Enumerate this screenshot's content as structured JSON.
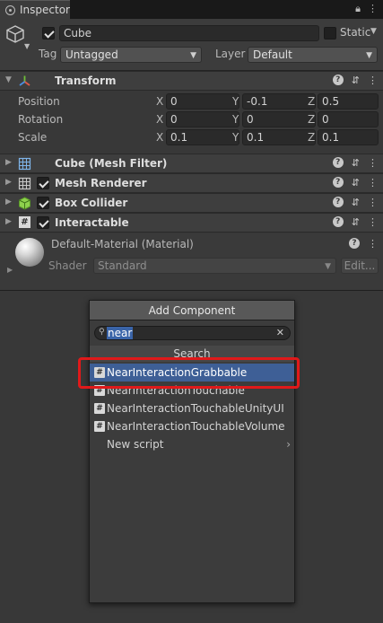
{
  "tab": {
    "title": "Inspector"
  },
  "object": {
    "name": "Cube",
    "static_label": "Static",
    "tag_label": "Tag",
    "tag_value": "Untagged",
    "layer_label": "Layer",
    "layer_value": "Default"
  },
  "transform": {
    "title": "Transform",
    "rows": [
      {
        "label": "Position",
        "x": "0",
        "y": "-0.1",
        "z": "0.5"
      },
      {
        "label": "Rotation",
        "x": "0",
        "y": "0",
        "z": "0"
      },
      {
        "label": "Scale",
        "x": "0.1",
        "y": "0.1",
        "z": "0.1"
      }
    ],
    "axis": {
      "x": "X",
      "y": "Y",
      "z": "Z"
    }
  },
  "components": [
    {
      "name": "Cube (Mesh Filter)",
      "icon": "mesh-filter-icon"
    },
    {
      "name": "Mesh Renderer",
      "icon": "mesh-renderer-icon"
    },
    {
      "name": "Box Collider",
      "icon": "box-collider-icon"
    },
    {
      "name": "Interactable",
      "icon": "script-icon"
    }
  ],
  "material": {
    "title": "Default-Material (Material)",
    "shader_label": "Shader",
    "shader_value": "Standard",
    "edit_label": "Edit..."
  },
  "popup": {
    "button_label": "Add Component",
    "search_value": "near",
    "section": "Search",
    "items": [
      "NearInteractionGrabbable",
      "NearInteractionTouchable",
      "NearInteractionTouchableUnityUI",
      "NearInteractionTouchableVolume"
    ],
    "new_script": "New script"
  },
  "colors": {
    "highlight": "#3e5f96",
    "annotation": "#e0191a"
  }
}
